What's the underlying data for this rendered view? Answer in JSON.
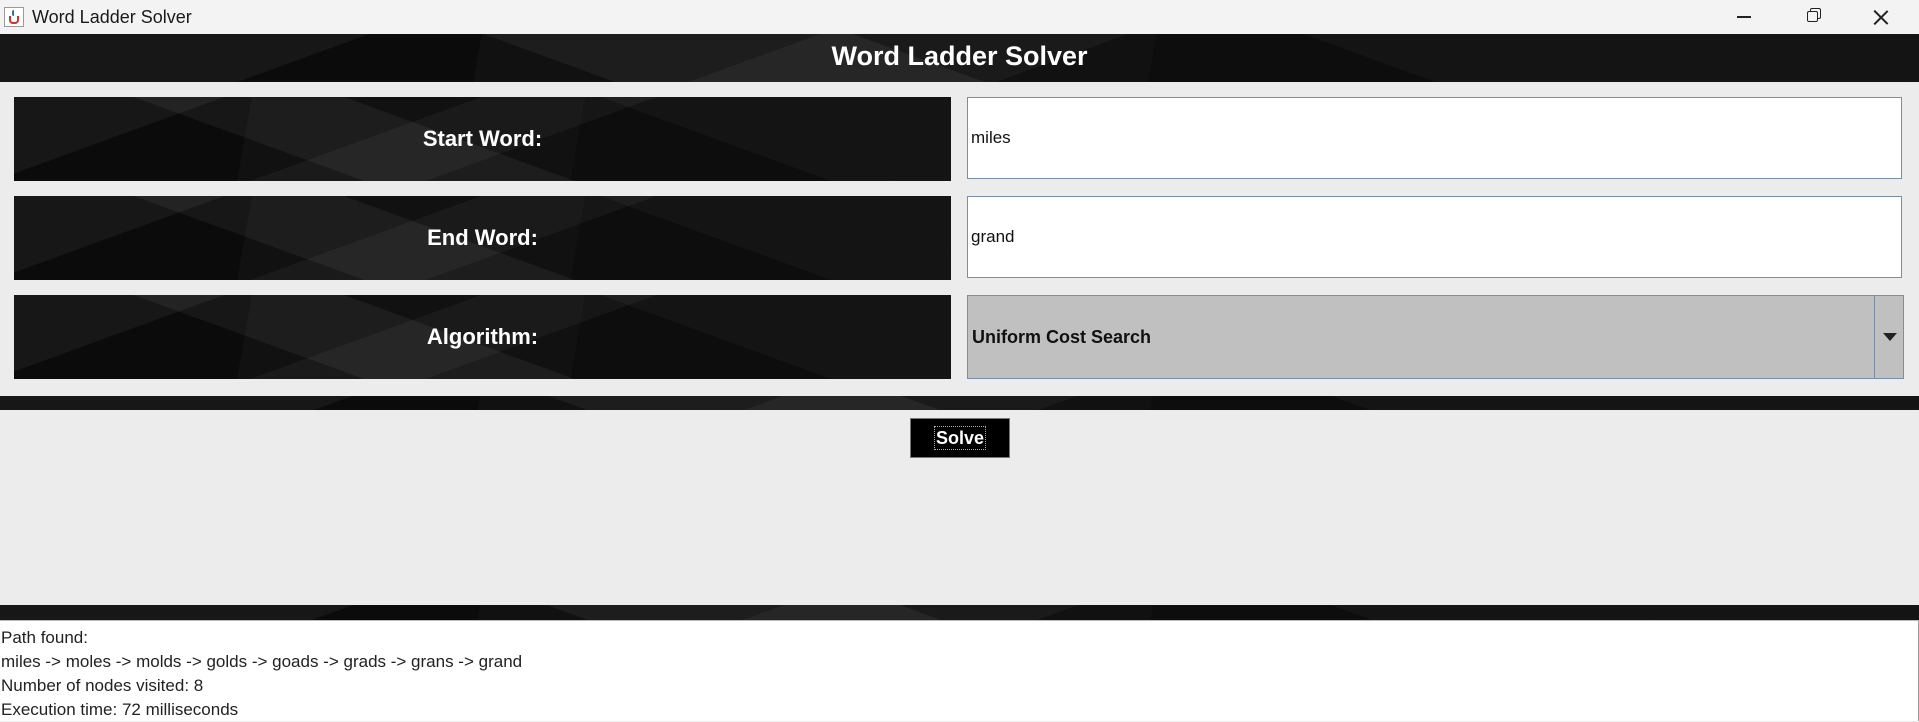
{
  "window": {
    "title": "Word Ladder Solver"
  },
  "header": {
    "title": "Word Ladder Solver"
  },
  "form": {
    "start_label": "Start Word:",
    "start_value": "miles",
    "end_label": "End Word:",
    "end_value": "grand",
    "algorithm_label": "Algorithm:",
    "algorithm_value": "Uniform Cost Search"
  },
  "actions": {
    "solve_label": "Solve"
  },
  "output": {
    "lines": [
      "Path found:",
      "miles -> moles -> molds -> golds -> goads -> grads -> grans -> grand",
      "Number of nodes visited: 8",
      "Execution time: 72 milliseconds"
    ]
  },
  "icons": {
    "app": "java-cup-icon",
    "minimize": "minimize-icon",
    "maximize": "restore-icon",
    "close": "close-icon",
    "dropdown": "chevron-down-icon"
  },
  "colors": {
    "dark_panel": "#111111",
    "combo_bg": "#c0c0c0",
    "window_bg": "#ececec"
  }
}
